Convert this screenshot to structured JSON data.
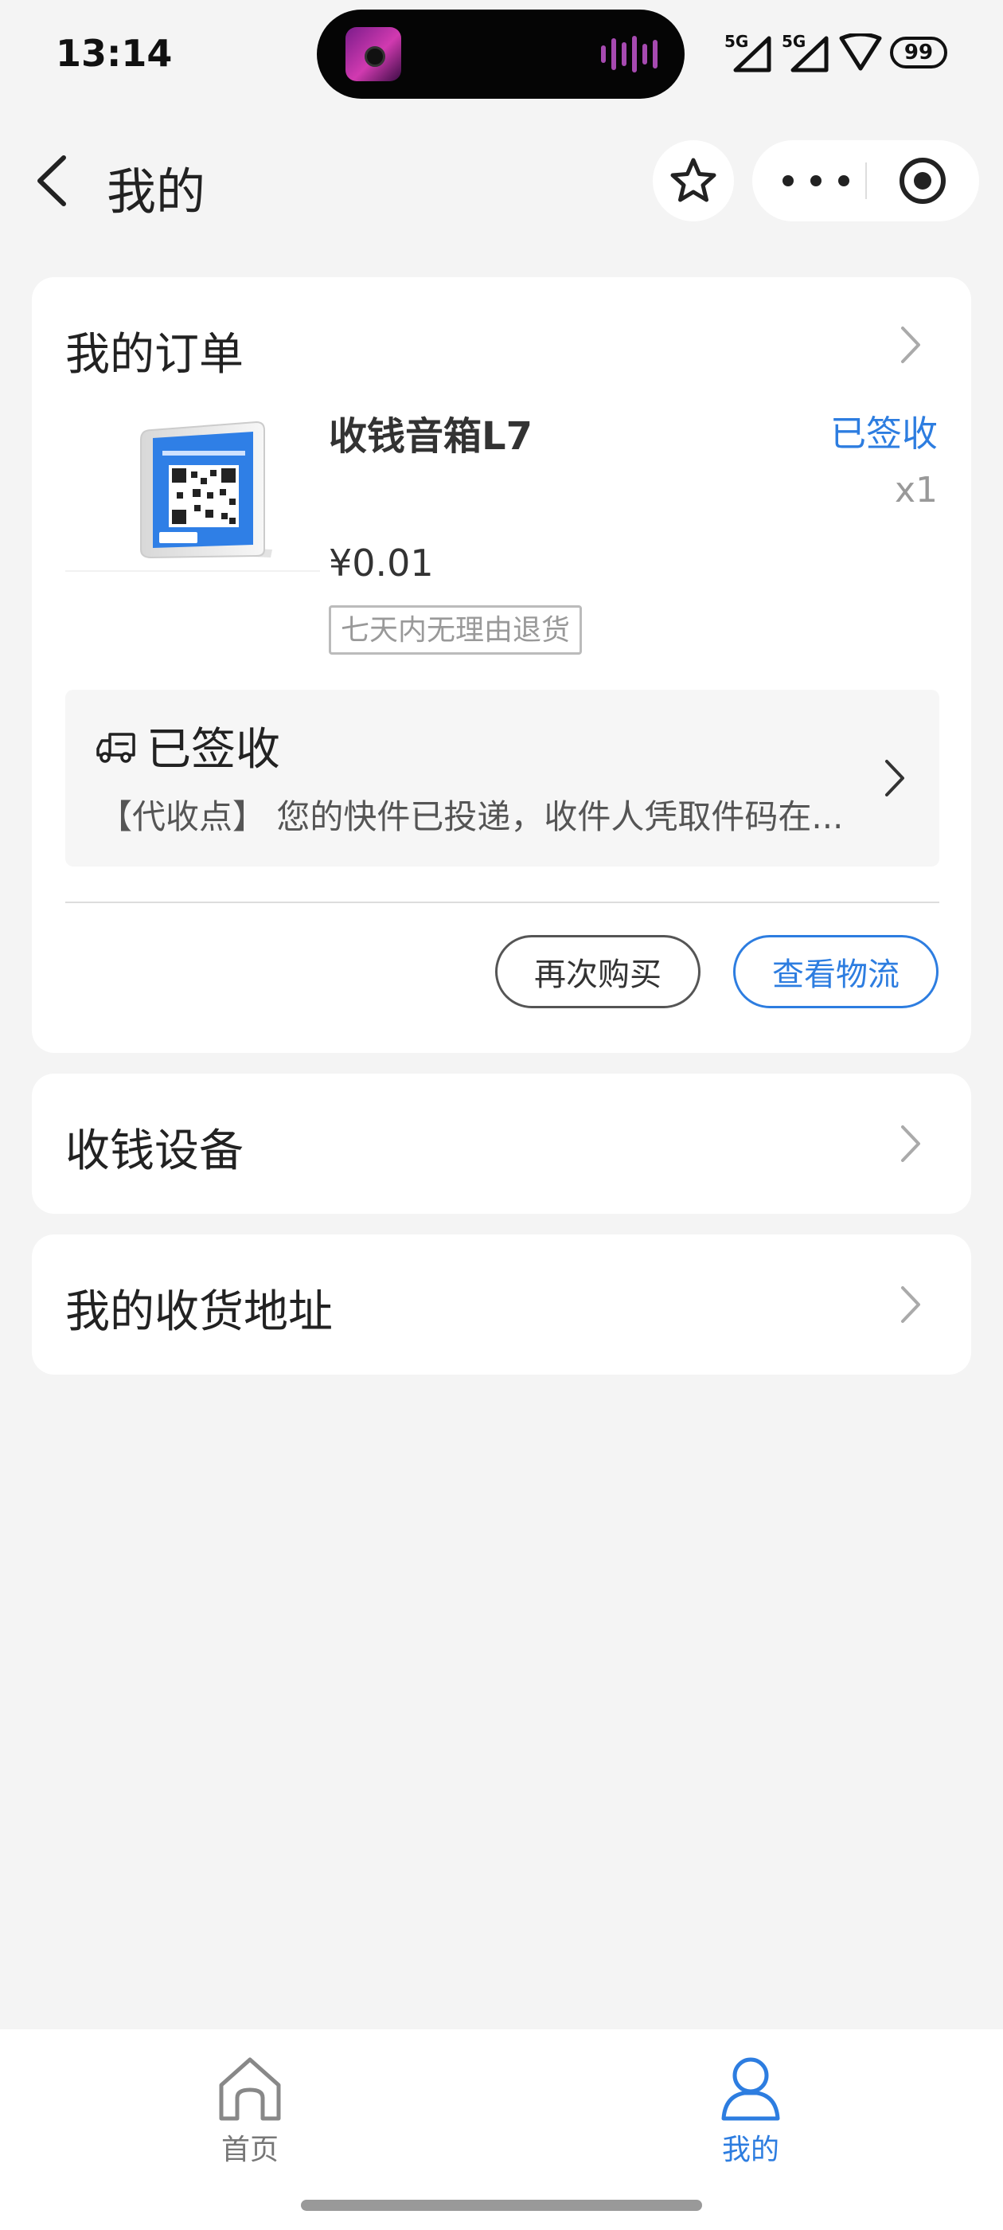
{
  "status_bar": {
    "time": "13:14",
    "signal_1": "5G",
    "signal_2": "5G",
    "battery": "99",
    "icons": [
      "media-island",
      "signal-icon",
      "signal-icon",
      "wifi-icon",
      "battery-icon"
    ]
  },
  "nav": {
    "title": "我的",
    "icons": [
      "back-icon",
      "star-icon",
      "more-icon",
      "close-target-icon"
    ]
  },
  "orders": {
    "title": "我的订单",
    "product": {
      "name": "收钱音箱L7",
      "status": "已签收",
      "quantity": "x1",
      "price": "¥0.01",
      "tag": "七天内无理由退货",
      "image_icon": "qr-speaker-image"
    },
    "logistics": {
      "status": "已签收",
      "detail": "【代收点】 您的快件已投递，收件人凭取件码在..."
    },
    "buttons": {
      "rebuy": "再次购买",
      "track": "查看物流"
    }
  },
  "menu": {
    "devices": "收钱设备",
    "address": "我的收货地址"
  },
  "tabbar": {
    "home": "首页",
    "mine": "我的",
    "active": "mine"
  },
  "colors": {
    "accent": "#2d7de0",
    "background": "#f4f4f4",
    "card": "#ffffff"
  }
}
